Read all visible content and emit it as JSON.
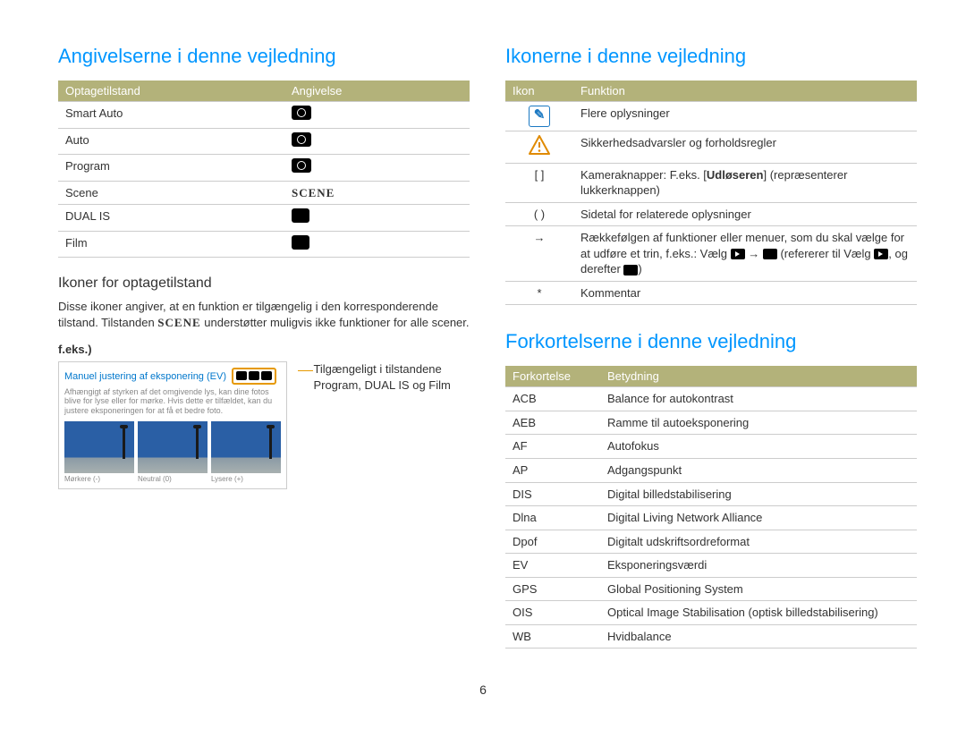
{
  "page_number": "6",
  "left": {
    "heading": "Angivelserne i denne vejledning",
    "table_headers": [
      "Optagetilstand",
      "Angivelse"
    ],
    "rows": [
      {
        "label": "Smart Auto",
        "icon": "smart-auto-icon"
      },
      {
        "label": "Auto",
        "icon": "auto-icon"
      },
      {
        "label": "Program",
        "icon": "program-icon"
      },
      {
        "label": "Scene",
        "icon": "scene-icon",
        "icon_text": "SCENE"
      },
      {
        "label": "DUAL IS",
        "icon": "dualis-icon"
      },
      {
        "label": "Film",
        "icon": "film-icon"
      }
    ],
    "sub_heading": "Ikoner for optagetilstand",
    "body_text": "Disse ikoner angiver, at en funktion er tilgængelig i den korresponderende tilstand. Tilstanden SCENE understøtter muligvis ikke funktioner for alle scener.",
    "feks": "f.eks.)",
    "example_title": "Manuel justering af eksponering (EV)",
    "example_desc": "Afhængigt af styrken af det omgivende lys, kan dine fotos blive for lyse eller for mørke. Hvis dette er tilfældet, kan du justere eksponeringen for at få et bedre foto.",
    "thumb_labels": [
      "Mørkere (-)",
      "Neutral (0)",
      "Lysere (+)"
    ],
    "callout": "Tilgængeligt i tilstandene Program, DUAL IS og Film"
  },
  "right_icons": {
    "heading": "Ikonerne i denne vejledning",
    "table_headers": [
      "Ikon",
      "Funktion"
    ],
    "rows": [
      {
        "icon": "note-icon",
        "text": "Flere oplysninger"
      },
      {
        "icon": "warning-icon",
        "text": "Sikkerhedsadvarsler og forholdsregler"
      },
      {
        "icon": "brackets-icon",
        "icon_text": "[ ]",
        "text_pre": "Kameraknapper: F.eks. [",
        "text_bold": "Udløseren",
        "text_post": "] (repræsenterer lukkerknappen)"
      },
      {
        "icon": "parens-icon",
        "icon_text": "( )",
        "text": "Sidetal for relaterede oplysninger"
      },
      {
        "icon": "arrow-icon",
        "icon_text": "→",
        "text_pre": "Rækkefølgen af funktioner eller menuer, som du skal vælge for at udføre et trin, f.eks.: Vælg ",
        "text_mid": " → ",
        "text_ref": " (refererer til Vælg ",
        "text_post": ", og derefter ",
        "text_end": ")"
      },
      {
        "icon": "asterisk-icon",
        "icon_text": "*",
        "text": "Kommentar"
      }
    ]
  },
  "right_abbrev": {
    "heading": "Forkortelserne i denne vejledning",
    "table_headers": [
      "Forkortelse",
      "Betydning"
    ],
    "rows": [
      {
        "abbr": "ACB",
        "meaning": "Balance for autokontrast"
      },
      {
        "abbr": "AEB",
        "meaning": "Ramme til autoeksponering"
      },
      {
        "abbr": "AF",
        "meaning": "Autofokus"
      },
      {
        "abbr": "AP",
        "meaning": "Adgangspunkt"
      },
      {
        "abbr": "DIS",
        "meaning": "Digital billedstabilisering"
      },
      {
        "abbr": "Dlna",
        "meaning": "Digital Living Network Alliance"
      },
      {
        "abbr": "Dpof",
        "meaning": "Digitalt udskriftsordreformat"
      },
      {
        "abbr": "EV",
        "meaning": "Eksponeringsværdi"
      },
      {
        "abbr": "GPS",
        "meaning": "Global Positioning System"
      },
      {
        "abbr": "OIS",
        "meaning": "Optical Image Stabilisation (optisk billedstabilisering)"
      },
      {
        "abbr": "WB",
        "meaning": "Hvidbalance"
      }
    ]
  }
}
